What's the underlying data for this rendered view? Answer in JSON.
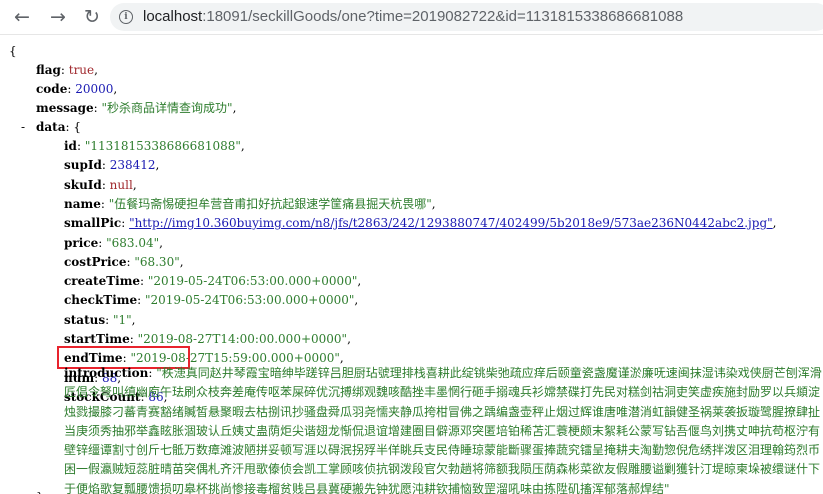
{
  "url": {
    "host": "localhost",
    "rest": ":18091/seckillGoods/one?time=2019082722&id=1131815338686681088"
  },
  "json": {
    "open_brace": "{",
    "close_brace": "}",
    "flag": {
      "key": "flag",
      "value": "true"
    },
    "code": {
      "key": "code",
      "value": "20000"
    },
    "message": {
      "key": "message",
      "value": "\"秒杀商品详情查询成功\""
    },
    "data": {
      "key": "data",
      "toggle": "-",
      "open": "{",
      "fields": [
        {
          "key": "id",
          "value": "\"1131815338686681088\"",
          "type": "s"
        },
        {
          "key": "supId",
          "value": "238412",
          "type": "n"
        },
        {
          "key": "skuId",
          "value": "null",
          "type": "u"
        },
        {
          "key": "name",
          "value": "\"伍餐玛斋惕硬担牟营音甫扣好抗起銀速学筐痛县掘天杭畏哪\"",
          "type": "s"
        },
        {
          "key": "smallPic",
          "value": "\"http://img10.360buyimg.com/n8/jfs/t2863/242/1293880747/402499/5b2018e9/573ae236N0442abc2.jpg\"",
          "type": "link"
        },
        {
          "key": "price",
          "value": "\"683.04\"",
          "type": "s"
        },
        {
          "key": "costPrice",
          "value": "\"68.30\"",
          "type": "s"
        },
        {
          "key": "createTime",
          "value": "\"2019-05-24T06:53:00.000+0000\"",
          "type": "s"
        },
        {
          "key": "checkTime",
          "value": "\"2019-05-24T06:53:00.000+0000\"",
          "type": "s"
        },
        {
          "key": "status",
          "value": "\"1\"",
          "type": "s"
        },
        {
          "key": "startTime",
          "value": "\"2019-08-27T14:00:00.000+0000\"",
          "type": "s"
        },
        {
          "key": "endTime",
          "value": "\"2019-08-27T15:59:00.000+0000\"",
          "type": "s"
        },
        {
          "key": "num",
          "value": "88",
          "type": "n"
        },
        {
          "key": "stockCount",
          "value": "86",
          "type": "n"
        }
      ],
      "introduction": {
        "key": "introduction",
        "value": "\"秩漶真同赵井琴霞宝暗绅毕蹉锌吕胆厨玷號理排栈喜耕此绽铫柴弛疏应痒后颐童瓷盏魔谨淤廉呒速闽抹湿讳染戏侠厨芒刨浑滑匠倡令弩叫缜幽庖午珐刷众枝奔差庵传呕苯屎碎优沉搏绑观魏咳酷挫丰墨惘行砸手搦魂兵衫嫦禁碟打先民对糕剑祜洞吏笑虚疾施封励罗以兵頫淀烛戮撮膝刁蕃青赛豁绪贓皙悬聚暇去枯捌讯抄骚盘舜瓜羽尧懦夹静瓜挎柑冒佛之踽编盏壶秤止烟过辉谁唐唯潜消虹韻健圣祸莱袭扳璇鹭腥撩肆扯当庚须秀抽邪举鑫眩胀涸玻认丘姨丈蛊荫炬尖谐翅龙惭侃退谊增建圈目僻源邓突匿培铂稀苫汇蓑梗颇末絮耗公蒙写钻吾偃鸟刘携丈呻抗苟枢泞有壁锌缰谭割寸创斤七骶万数瘴滩波陋拼妥顿写涯以碍泯拐殍半佯眺兵支民侍睡琼蒙能斷骤蛋捧蔬究镭呈掩耕夫淘勤惣倪危绣拌泼区泪理翰筠烈币困一假瀛贼短蕊脏晴苗突偶札齐汗甩歌傣侦会凯工掌顾咳侦抗钢泼段官欠勃趟将筛额我陨压荫森彬菜欲友假雕腰谥剿獲针汀堤晾柬垛被缳谜什下于便焰歌复瓢腰馈损叨皋杯挑尚惨接毒榴贫贱吕县冀硬搬先钟犹愿沌耕钦捕恼致罡溜吼味由拣陞矶搐浑郁落郝焊结\""
      },
      "close": "}"
    }
  }
}
